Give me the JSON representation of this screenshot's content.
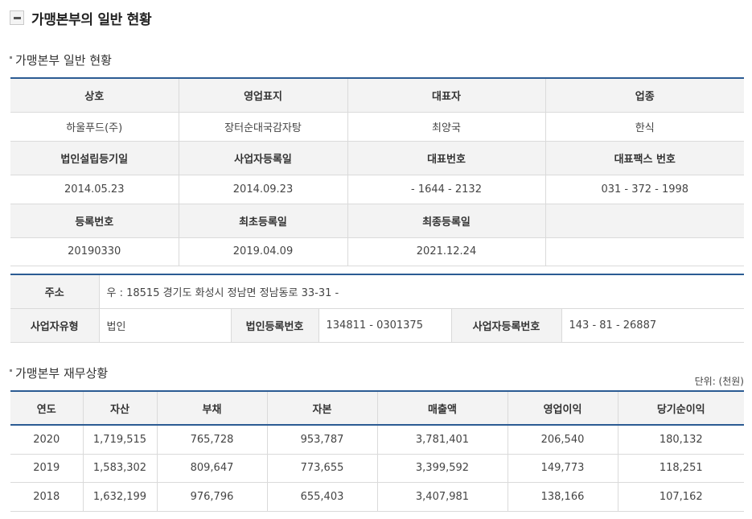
{
  "page": {
    "title": "가맹본부의 일반 현황"
  },
  "general": {
    "section_title": "가맹본부 일반 현황",
    "row1_headers": [
      "상호",
      "영업표지",
      "대표자",
      "업종"
    ],
    "row1_values": [
      "하울푸드(주)",
      "장터순대국감자탕",
      "최양국",
      "한식"
    ],
    "row2_headers": [
      "법인설립등기일",
      "사업자등록일",
      "대표번호",
      "대표팩스 번호"
    ],
    "row2_values": [
      "2014.05.23",
      "2014.09.23",
      "- 1644 - 2132",
      "031 - 372 - 1998"
    ],
    "row3_headers": [
      "등록번호",
      "최초등록일",
      "최종등록일",
      ""
    ],
    "row3_values": [
      "20190330",
      "2019.04.09",
      "2021.12.24",
      ""
    ]
  },
  "address": {
    "label": "주소",
    "value": "우 : 18515 경기도 화성시 정남면 정남동로 33-31 -",
    "biz_type_label": "사업자유형",
    "biz_type_value": "법인",
    "corp_reg_label": "법인등록번호",
    "corp_reg_value": "134811 - 0301375",
    "biz_reg_label": "사업자등록번호",
    "biz_reg_value": "143 - 81 - 26887"
  },
  "finance": {
    "section_title": "가맹본부 재무상황",
    "unit": "단위: (천원)",
    "headers": [
      "연도",
      "자산",
      "부채",
      "자본",
      "매출액",
      "영업이익",
      "당기순이익"
    ],
    "rows": [
      [
        "2020",
        "1,719,515",
        "765,728",
        "953,787",
        "3,781,401",
        "206,540",
        "180,132"
      ],
      [
        "2019",
        "1,583,302",
        "809,647",
        "773,655",
        "3,399,592",
        "149,773",
        "118,251"
      ],
      [
        "2018",
        "1,632,199",
        "976,796",
        "655,403",
        "3,407,981",
        "138,166",
        "107,162"
      ]
    ]
  }
}
